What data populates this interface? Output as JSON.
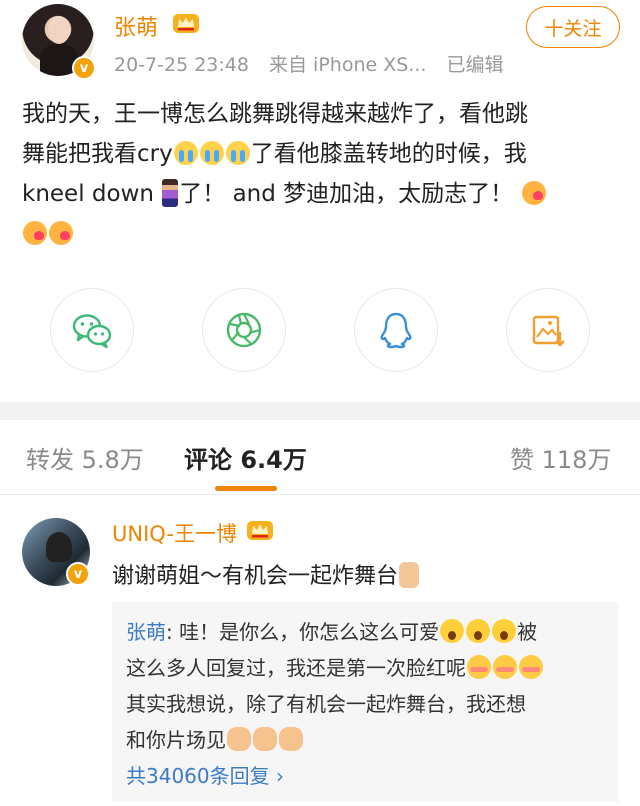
{
  "post": {
    "author": "张萌",
    "time": "20-7-25 23:48",
    "source": "来自 iPhone XS...",
    "edited": "已编辑",
    "follow_label": "十关注",
    "text_line1": "我的天，王一博怎么跳舞跳得越来越炸了，看他跳",
    "text_line2a": "舞能把我看cry",
    "text_line2b": "了看他膝盖转地的时候，我",
    "text_line3a": "kneel down ",
    "text_line3b": "了！ and 梦迪加油，太励志了！"
  },
  "share": {
    "icons": [
      "wechat-icon",
      "moments-icon",
      "qq-icon",
      "save-image-icon"
    ]
  },
  "tabs": {
    "repost": "转发 5.8万",
    "comments": "评论 6.4万",
    "likes": "赞 118万"
  },
  "comment": {
    "author": "UNIQ-王一博",
    "text": "谢谢萌姐～有机会一起炸舞台"
  },
  "reply": {
    "author": "张萌",
    "sep": ": ",
    "line1a": "哇！是你么，你怎么这么可爱",
    "line1b": "被",
    "line2": "这么多人回复过，我还是第一次脸红呢",
    "line3": "其实我想说，除了有机会一起炸舞台，我还想",
    "line4": "和你片场见",
    "more": "共34060条回复 ›"
  },
  "colors": {
    "accent": "#f08300",
    "link": "#3d7bc4",
    "wechat": "#3cb878",
    "moments": "#4ab86a",
    "qq": "#3a8fd6",
    "save": "#f0a030"
  }
}
